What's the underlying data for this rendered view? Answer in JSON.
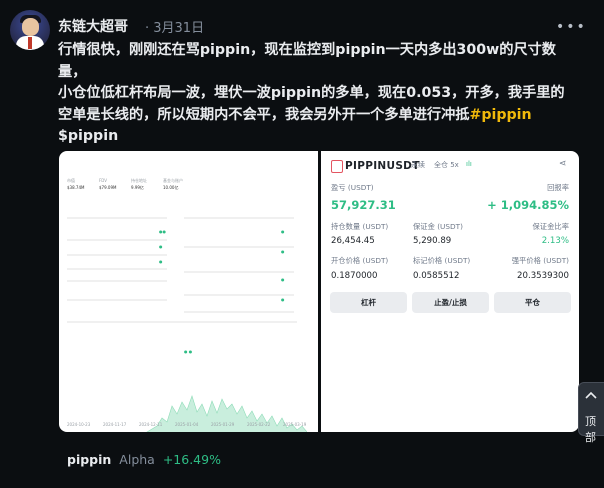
{
  "post": {
    "author": "东链大超哥",
    "date": "3月31日",
    "more_icon": "more-dots-icon",
    "text_line1": "行情很快，刚刚还在骂pippin，现在监控到pippin一天内多出300w的尺寸数量，",
    "text_line2": "小仓位低杠杆布局一波，埋伏一波pippin的多单，现在0.053，开多，我手里的空单是长线的，所以短期内不会平，我会另外开一个多单进行冲抵",
    "hashtag": "#pippin",
    "cashtag": "$pippin"
  },
  "left_screenshot": {
    "stats_labels": [
      "市值",
      "FDV",
      "持仓地址",
      "基金与账户"
    ],
    "stats_values": [
      "$38.74M",
      "$79.09M",
      "9.99亿",
      "10.00亿"
    ],
    "chart_dates": [
      "2024-10-23",
      "2024-11-17",
      "2024-12-11",
      "2025-01-04",
      "2025-01-29",
      "2025-02-22",
      "2025-03-19"
    ]
  },
  "position_card": {
    "symbol": "PIPPINUSDT",
    "type_tag": "永续",
    "margin_mode": "全仓 5x",
    "pnl_label": "盈亏 (USDT)",
    "pnl_value": "57,927.31",
    "roi_label": "回报率",
    "roi_value": "+ 1,094.85%",
    "size_label": "持仓数量 (USDT)",
    "size_value": "26,454.45",
    "margin_label": "保证金 (USDT)",
    "margin_value": "5,290.89",
    "margin_ratio_label": "保证金比率",
    "margin_ratio_value": "2.13%",
    "entry_label": "开仓价格 (USDT)",
    "entry_value": "0.1870000",
    "mark_label": "标记价格 (USDT)",
    "mark_value": "0.0585512",
    "liq_label": "强平价格 (USDT)",
    "liq_value": "20.3539300",
    "buttons": [
      "杠杆",
      "止盈/止损",
      "平仓"
    ]
  },
  "side_button": {
    "label": "顶部",
    "icon": "arrow-up-icon"
  },
  "footer": {
    "symbol": "pippin",
    "tag": "Alpha",
    "change": "+16.49%"
  },
  "colors": {
    "accent": "#f0b90b",
    "positive": "#2ebd85",
    "background": "#0b0e11"
  }
}
